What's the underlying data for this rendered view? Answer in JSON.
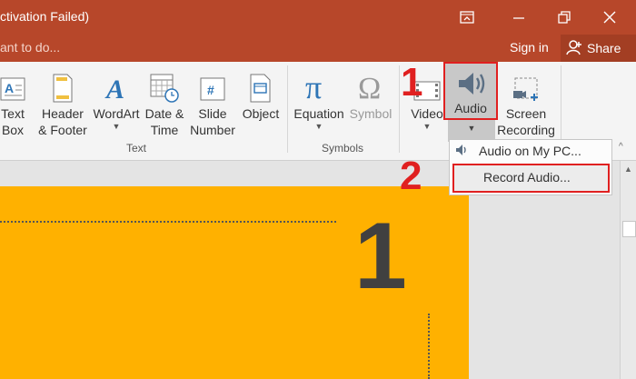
{
  "titlebar": {
    "title": "ctivation Failed)"
  },
  "tellbar": {
    "tell_me": "ant to do...",
    "sign_in": "Sign in",
    "share": "Share"
  },
  "ribbon": {
    "buttons": [
      {
        "label": "Text\nBox",
        "icon": "textbox-icon"
      },
      {
        "label": "Header\n& Footer",
        "icon": "header-footer-icon"
      },
      {
        "label": "WordArt",
        "icon": "wordart-icon"
      },
      {
        "label": "Date &\nTime",
        "icon": "date-time-icon"
      },
      {
        "label": "Slide\nNumber",
        "icon": "slide-number-icon"
      },
      {
        "label": "Object",
        "icon": "object-icon"
      },
      {
        "label": "Equation",
        "icon": "pi-icon"
      },
      {
        "label": "Symbol",
        "icon": "omega-icon"
      },
      {
        "label": "Video",
        "icon": "video-icon"
      },
      {
        "label": "Audio",
        "icon": "speaker-icon"
      },
      {
        "label": "Screen\nRecording",
        "icon": "screen-recording-icon"
      }
    ],
    "groups": {
      "text": "Text",
      "symbols": "Symbols"
    }
  },
  "audio_menu": {
    "items": [
      {
        "label": "Audio on My PC...",
        "icon": "speaker-small-icon"
      },
      {
        "label": "Record Audio..."
      }
    ]
  },
  "annotations": {
    "step1": "1",
    "step2": "2"
  },
  "slide": {
    "number": "1"
  },
  "colors": {
    "accent": "#b7472a",
    "highlight": "#e02020",
    "slide_bg": "#ffb100"
  }
}
